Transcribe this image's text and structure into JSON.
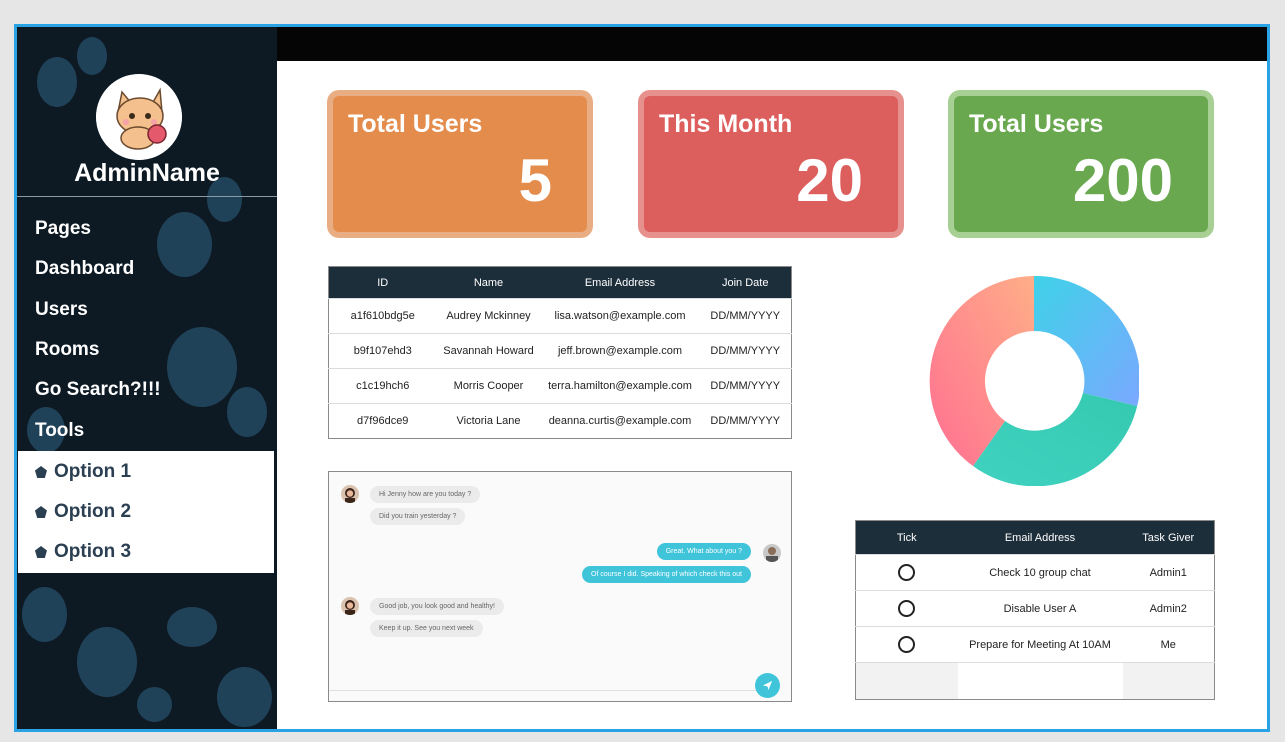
{
  "sidebar": {
    "admin_name": "AdminName",
    "avatar_icon": "cat-avatar-icon",
    "menu": [
      "Pages",
      "Dashboard",
      "Users",
      "Rooms",
      "Go Search?!!!",
      "Tools"
    ],
    "submenu": [
      "Option 1",
      "Option 2",
      "Option 3"
    ],
    "submenu_icon": "pentagon-icon"
  },
  "cards": [
    {
      "title": "Total Users",
      "value": "5",
      "color": "#e38c4c",
      "border": "#e9ad84"
    },
    {
      "title": "This Month",
      "value": "20",
      "color": "#dc5f5e",
      "border": "#e7918f"
    },
    {
      "title": "Total Users",
      "value": "200",
      "color": "#6aa84f",
      "border": "#a9d094"
    }
  ],
  "users_table": {
    "headers": [
      "ID",
      "Name",
      "Email Address",
      "Join Date"
    ],
    "rows": [
      [
        "a1f610bdg5e",
        "Audrey Mckinney",
        "lisa.watson@example.com",
        "DD/MM/YYYY"
      ],
      [
        "b9f107ehd3",
        "Savannah Howard",
        "jeff.brown@example.com",
        "DD/MM/YYYY"
      ],
      [
        "c1c19hch6",
        "Morris Cooper",
        "terra.hamilton@example.com",
        "DD/MM/YYYY"
      ],
      [
        "d7f96dce9",
        "Victoria Lane",
        "deanna.curtis@example.com",
        "DD/MM/YYYY"
      ]
    ]
  },
  "chat": {
    "messages": [
      {
        "from": "in",
        "text": "Hi Jenny how are you today ?"
      },
      {
        "from": "in",
        "text": "Did you train yesterday ?"
      },
      {
        "from": "out",
        "text": "Great. What about you ?"
      },
      {
        "from": "out",
        "text": "Of course I did. Speaking of which check this out"
      },
      {
        "from": "in",
        "text": "Good job, you look good and healthy!"
      },
      {
        "from": "in",
        "text": "Keep it up. See you next week"
      }
    ],
    "send_icon": "send-icon"
  },
  "tasks_table": {
    "headers": [
      "Tick",
      "Email Address",
      "Task Giver"
    ],
    "rows": [
      [
        "Check 10 group chat",
        "Admin1"
      ],
      [
        "Disable User A",
        "Admin2"
      ],
      [
        "Prepare for Meeting At 10AM",
        "Me"
      ]
    ]
  },
  "donut": {
    "colors": [
      "#3fd2e8",
      "#36c9b0",
      "#ff6f91",
      "#ffae88",
      "#7aa8ff"
    ]
  }
}
